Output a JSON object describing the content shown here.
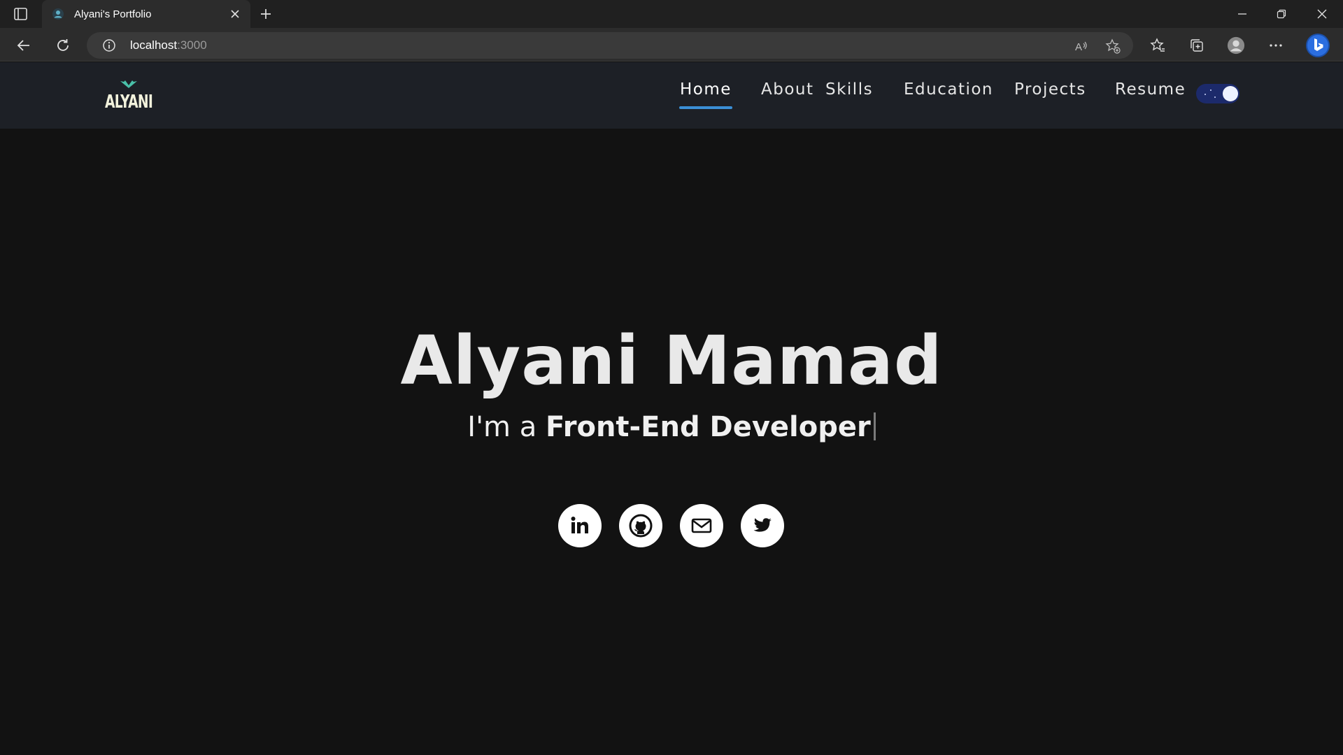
{
  "browser": {
    "tab": {
      "title": "Alyani's Portfolio"
    },
    "address": {
      "host": "localhost",
      "port": ":3000"
    }
  },
  "site": {
    "logo": {
      "text": "ALYANI"
    },
    "nav": [
      {
        "label": "Home",
        "active": true
      },
      {
        "label": "About",
        "active": false
      },
      {
        "label": "Skills",
        "active": false
      },
      {
        "label": "Education",
        "active": false
      },
      {
        "label": "Projects",
        "active": false
      },
      {
        "label": "Resume",
        "active": false
      }
    ],
    "theme_toggle": {
      "state": "dark"
    }
  },
  "hero": {
    "name": "Alyani Mamad",
    "prefix": "I'm a ",
    "role": "Front-End Developer",
    "socials": [
      {
        "icon": "linkedin-icon",
        "label": "LinkedIn"
      },
      {
        "icon": "github-icon",
        "label": "GitHub"
      },
      {
        "icon": "mail-icon",
        "label": "Email"
      },
      {
        "icon": "twitter-icon",
        "label": "Twitter"
      }
    ]
  },
  "colors": {
    "page_bg": "#121212",
    "nav_bg": "#1d2026",
    "accent_underline": "#3b8fd6",
    "toggle_bg": "#1c2a6b"
  }
}
